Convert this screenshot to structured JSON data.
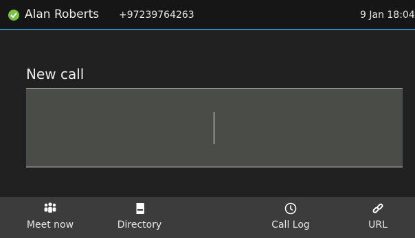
{
  "status_bar": {
    "user_name": "Alan Roberts",
    "number": "+97239764263",
    "datetime": "9 Jan 18:04",
    "presence_color": "#7ac143",
    "presence_icon": "available-check-icon",
    "accent_line_color": "#2a8cc4"
  },
  "main": {
    "title": "New call",
    "dial_input_value": ""
  },
  "softkeys": [
    {
      "label": "Meet now",
      "icon": "people-group-icon"
    },
    {
      "label": "Directory",
      "icon": "address-book-icon"
    },
    {
      "label": "Call Log",
      "icon": "clock-icon"
    },
    {
      "label": "URL",
      "icon": "link-icon"
    }
  ]
}
